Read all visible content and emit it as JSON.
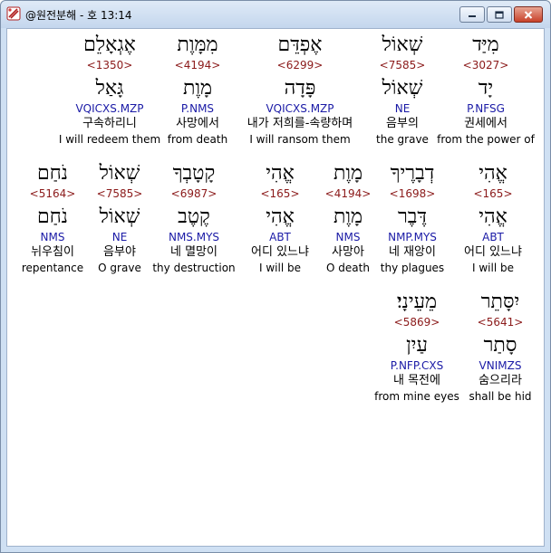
{
  "window": {
    "title": "@원전분해 - 호 13:14",
    "icon": "app-icon",
    "controls": [
      "minimize-icon",
      "maximize-icon",
      "close-icon"
    ]
  },
  "rows": [
    [
      {
        "heb": "מִיַּד",
        "strong": "<3027>",
        "root": "יָד",
        "parse": "P.NFSG",
        "kor": "권세에서",
        "eng": "from the power of"
      },
      {
        "heb": "שְׁאוֹל",
        "strong": "<7585>",
        "root": "שְׁאוֹל",
        "parse": "NE",
        "kor": "음부의",
        "eng": "the grave"
      },
      {
        "heb": "אֶפְדֵּם",
        "strong": "<6299>",
        "root": "פָּדָה",
        "parse": "VQICXS.MZP",
        "kor": "내가 저희를-속량하며",
        "eng": "I will ransom them"
      },
      {
        "heb": "מִמָּוֶת",
        "strong": "<4194>",
        "root": "מָוֶת",
        "parse": "P.NMS",
        "kor": "사망에서",
        "eng": "from death"
      },
      {
        "heb": "אֶגְאָלֵם",
        "strong": "<1350>",
        "root": "גָּאַל",
        "parse": "VQICXS.MZP",
        "kor": "구속하리니",
        "eng": "I will redeem them"
      }
    ],
    [
      {
        "heb": "אֱהִי",
        "strong": "<165>",
        "root": "אֱהִי",
        "parse": "ABT",
        "kor": "어디 있느냐",
        "eng": "I will be"
      },
      {
        "heb": "דְבָרֶיךָ",
        "strong": "<1698>",
        "root": "דֶּבֶר",
        "parse": "NMP.MYS",
        "kor": "네 재앙이",
        "eng": "thy plagues"
      },
      {
        "heb": "מָוֶת",
        "strong": "<4194>",
        "root": "מָוֶת",
        "parse": "NMS",
        "kor": "사망아",
        "eng": "O death"
      },
      {
        "heb": "אֱהִי",
        "strong": "<165>",
        "root": "אֱהִי",
        "parse": "ABT",
        "kor": "어디 있느냐",
        "eng": "I will be"
      },
      {
        "heb": "קָטָבְךָ",
        "strong": "<6987>",
        "root": "קֶטֶב",
        "parse": "NMS.MYS",
        "kor": "네 멸망이",
        "eng": "thy destruction"
      },
      {
        "heb": "שְׁאוֹל",
        "strong": "<7585>",
        "root": "שְׁאוֹל",
        "parse": "NE",
        "kor": "음부야",
        "eng": "O grave"
      },
      {
        "heb": "נֹחַם",
        "strong": "<5164>",
        "root": "נֹחַם",
        "parse": "NMS",
        "kor": "뉘우침이",
        "eng": "repentance"
      }
    ],
    [
      {
        "heb": "יִסָּתֵר",
        "strong": "<5641>",
        "root": "סָתַר",
        "parse": "VNIMZS",
        "kor": "숨으리라",
        "eng": "shall be hid"
      },
      {
        "heb": "מֵעֵינָי׃",
        "strong": "<5869>",
        "root": "עַיִן",
        "parse": "P.NFP.CXS",
        "kor": "내 목전에",
        "eng": "from mine eyes"
      }
    ]
  ]
}
